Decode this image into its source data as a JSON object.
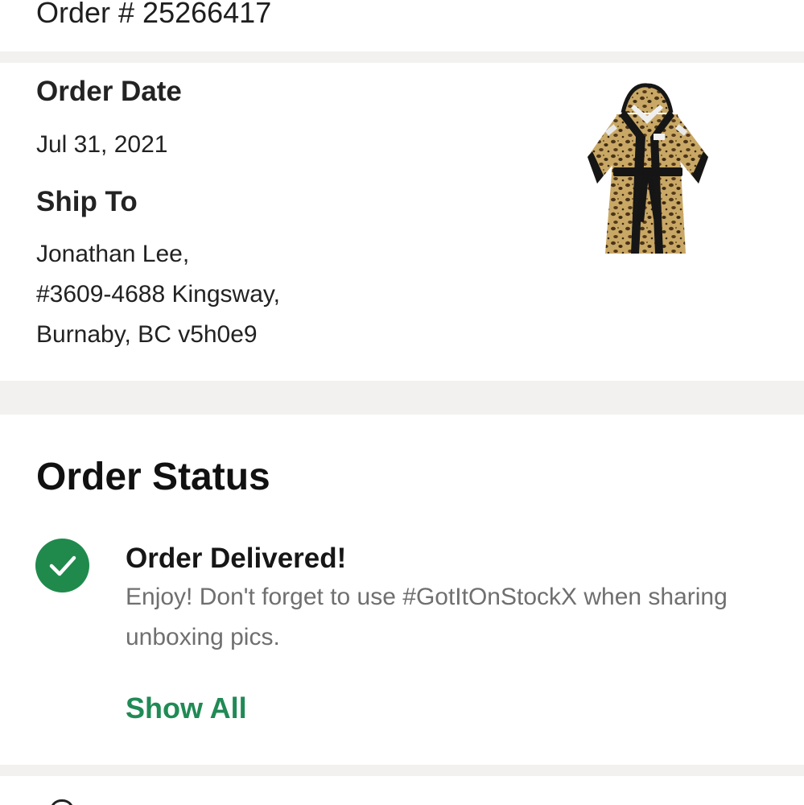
{
  "order": {
    "number_text": "Order # 25266417"
  },
  "details": {
    "order_date_label": "Order Date",
    "order_date": "Jul 31, 2021",
    "ship_to_label": "Ship To",
    "address": [
      "Jonathan Lee,",
      "#3609-4688 Kingsway,",
      "Burnaby, BC v5h0e9"
    ],
    "product_image_icon": "leopard-print-robe-image"
  },
  "status": {
    "section_title": "Order Status",
    "check_icon": "check-circle-icon",
    "title": "Order Delivered!",
    "description": "Enjoy! Don't forget to use #GotItOnStockX when sharing unboxing pics.",
    "show_all_label": "Show All"
  },
  "colors": {
    "accent_green": "#208a55",
    "check_green": "#1f8a4c",
    "divider_gray": "#f2f1ef",
    "muted_text": "#6f6f6f"
  }
}
